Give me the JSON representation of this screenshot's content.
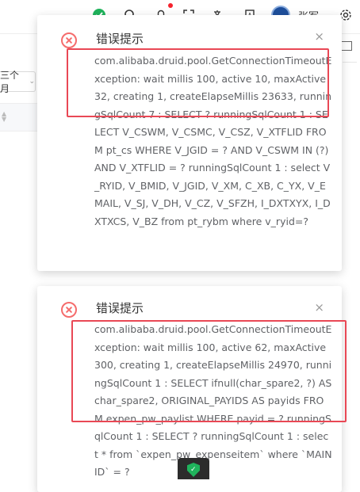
{
  "header": {
    "username": "张军",
    "icons": [
      "app-logo-icon",
      "search-icon",
      "bell-icon",
      "fullscreen-icon",
      "translate-icon",
      "download-icon",
      "avatar",
      "settings-icon"
    ]
  },
  "filter": {
    "month_select_value": "三个月"
  },
  "toasts": [
    {
      "title": "错误提示",
      "close": "×",
      "message": "com.alibaba.druid.pool.GetConnectionTimeoutException: wait millis 100, active 10, maxActive 32, creating 1, createElapseMillis 23633, runningSqlCount 7 : SELECT ? runningSqlCount 1 : SELECT V_CSWM, V_CSMC, V_CSZ, V_XTFLID FROM pt_cs WHERE V_JGID = ? AND V_CSWM IN (?) AND V_XTFLID = ? runningSqlCount 1 : select V_RYID, V_BMID, V_JGID, V_XM, C_XB, C_YX, V_EMAIL, V_SJ, V_DH, V_CZ, V_SFZH, I_DXTXYX, I_DXTXCS, V_BZ from pt_rybm where v_ryid=?"
    },
    {
      "title": "错误提示",
      "close": "×",
      "message": "com.alibaba.druid.pool.GetConnectionTimeoutException: wait millis 100, active 62, maxActive 300, creating 1, createElapseMillis 24970, runningSqlCount 1 : SELECT ifnull(char_spare2, ?) AS char_spare2, ORIGINAL_PAYIDS AS payids FROM expen_pw_paylist WHERE payid = ? runningSqlCount 1 : SELECT ? runningSqlCount 1 : select * from `expen_pw_expenseitem` where `MAINID` = ?"
    }
  ],
  "colors": {
    "error": "#f56c6c",
    "highlight": "#e94855",
    "shield": "#1fb45c"
  }
}
